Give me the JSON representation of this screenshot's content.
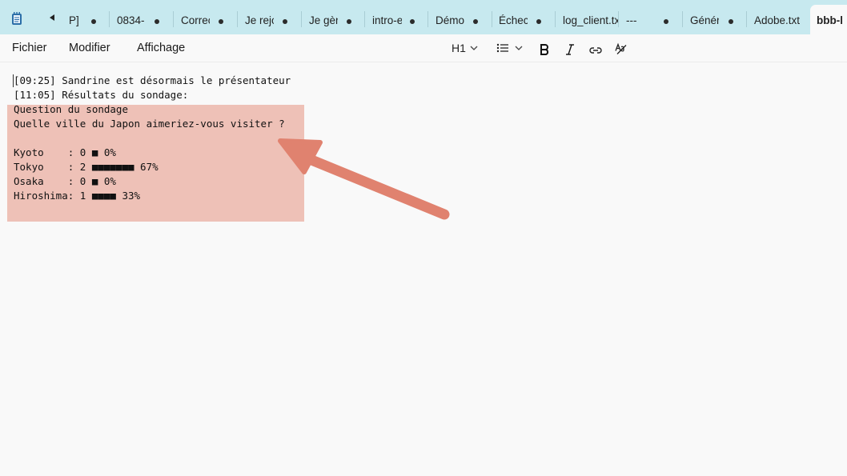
{
  "tabs": [
    {
      "label": "P]"
    },
    {
      "label": "0834-"
    },
    {
      "label": "Correc"
    },
    {
      "label": "Je rejo"
    },
    {
      "label": "Je gèr"
    },
    {
      "label": "intro-e"
    },
    {
      "label": "Démo"
    },
    {
      "label": "Échec"
    },
    {
      "label": "log_client.tx"
    },
    {
      "label": "---"
    },
    {
      "label": "Génér"
    },
    {
      "label": "Adobe.txt"
    },
    {
      "label": "bbb-l"
    }
  ],
  "menu": {
    "file": "Fichier",
    "edit": "Modifier",
    "view": "Affichage"
  },
  "toolbar": {
    "heading": "H1"
  },
  "document": {
    "lines": [
      "[09:25] Sandrine est désormais le présentateur",
      "[11:05] Résultats du sondage:",
      "Question du sondage",
      "Quelle ville du Japon aimeriez-vous visiter ?",
      "",
      "Kyoto    : 0 ■ 0%",
      "Tokyo    : 2 ■■■■■■■ 67%",
      "Osaka    : 0 ■ 0%",
      "Hiroshima: 1 ■■■■ 33%"
    ]
  },
  "colors": {
    "tabbar": "#c7e9ef",
    "highlight": "#e8a393",
    "arrow": "#e0826f"
  }
}
